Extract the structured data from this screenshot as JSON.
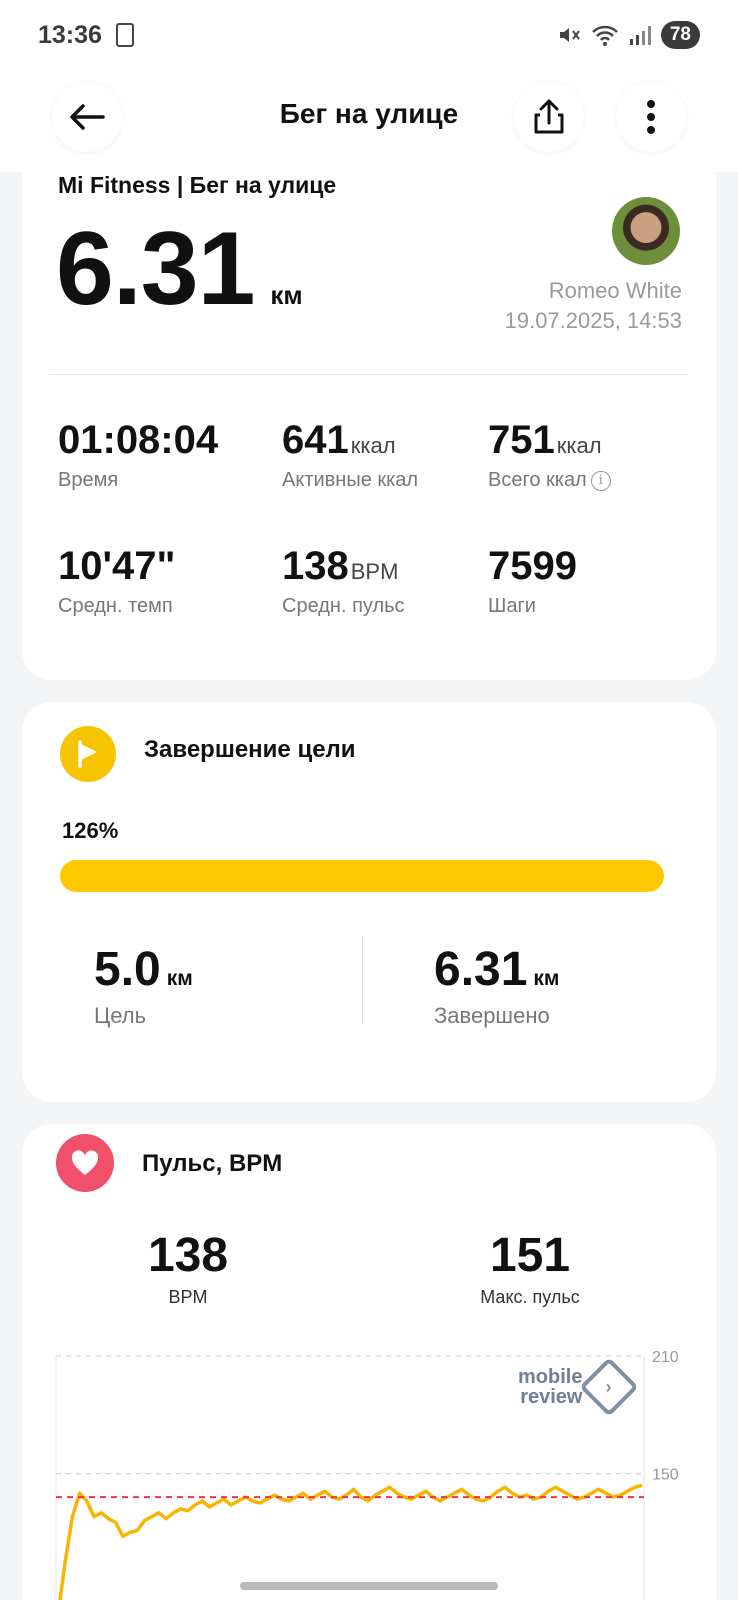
{
  "status_bar": {
    "time": "13:36",
    "battery": "78",
    "icons": [
      "document-icon",
      "mute-icon",
      "wifi-icon",
      "signal-icon"
    ]
  },
  "header": {
    "title": "Бег на улице",
    "icons": [
      "back-arrow-icon",
      "share-icon",
      "more-vertical-icon"
    ]
  },
  "summary": {
    "source": "Mi Fitness | Бег на улице",
    "distance": "6.31",
    "distance_unit": "км",
    "user_name": "Romeo White",
    "datetime": "19.07.2025, 14:53",
    "stats": [
      {
        "value": "01:08:04",
        "unit": "",
        "label": "Время"
      },
      {
        "value": "641",
        "unit": "ккал",
        "label": "Активные ккал"
      },
      {
        "value": "751",
        "unit": "ккал",
        "label": "Всего ккал",
        "info": "i"
      },
      {
        "value": "10'47\"",
        "unit": "",
        "label": "Средн. темп"
      },
      {
        "value": "138",
        "unit": "BPM",
        "label": "Средн. пульс"
      },
      {
        "value": "7599",
        "unit": "",
        "label": "Шаги"
      }
    ]
  },
  "goal": {
    "title": "Завершение цели",
    "percent_text": "126%",
    "progress_fraction": 1.0,
    "target_value": "5.0",
    "target_unit": "км",
    "target_label": "Цель",
    "done_value": "6.31",
    "done_unit": "км",
    "done_label": "Завершено",
    "accent_color": "#ffc800"
  },
  "heart_rate": {
    "title": "Пульс, BPM",
    "avg_value": "138",
    "avg_label": "BPM",
    "max_value": "151",
    "max_label": "Макс. пульс",
    "accent_color": "#f0506a",
    "watermark_line1": "mobile",
    "watermark_line2": "review"
  },
  "chart_data": {
    "type": "line",
    "y_ticks": [
      "210",
      "150"
    ],
    "ylim": [
      60,
      210
    ],
    "avg_line": 138,
    "series": [
      {
        "values": [
          78,
          105,
          128,
          140,
          136,
          128,
          130,
          127,
          125,
          118,
          120,
          121,
          126,
          128,
          130,
          127,
          130,
          132,
          131,
          134,
          136,
          133,
          135,
          137,
          134,
          136,
          138,
          136,
          135,
          137,
          139,
          137,
          136,
          138,
          140,
          137,
          139,
          141,
          138,
          137,
          139,
          142,
          138,
          136,
          139,
          141,
          143,
          140,
          138,
          137,
          139,
          141,
          138,
          136,
          138,
          140,
          142,
          139,
          137,
          136,
          138,
          141,
          143,
          140,
          138,
          139,
          137,
          138,
          141,
          143,
          141,
          139,
          137,
          138,
          140,
          142,
          140,
          138,
          139,
          141,
          143,
          144
        ]
      }
    ]
  }
}
